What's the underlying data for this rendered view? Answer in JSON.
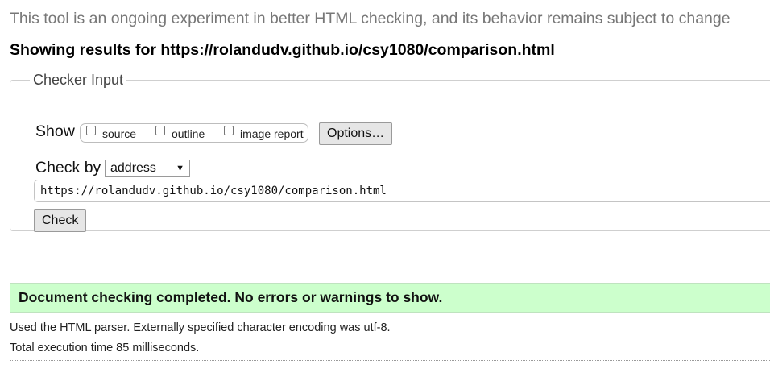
{
  "intro_text": "This tool is an ongoing experiment in better HTML checking, and its behavior remains subject to change",
  "results_heading": "Showing results for https://rolandudv.github.io/csy1080/comparison.html",
  "checker": {
    "legend": "Checker Input",
    "show_label": "Show",
    "show_options": [
      {
        "label": "source",
        "checked": false
      },
      {
        "label": "outline",
        "checked": false
      },
      {
        "label": "image report",
        "checked": false
      }
    ],
    "options_button": "Options…",
    "check_by_label": "Check by",
    "check_by_value": "address",
    "url_value": "https://rolandudv.github.io/csy1080/comparison.html",
    "check_button": "Check"
  },
  "result": {
    "success_message": "Document checking completed. No errors or warnings to show.",
    "parser_info": "Used the HTML parser. Externally specified character encoding was utf-8.",
    "execution_time": "Total execution time 85 milliseconds."
  },
  "colors": {
    "success_bg": "#ccffcc",
    "intro_text": "#777777"
  }
}
